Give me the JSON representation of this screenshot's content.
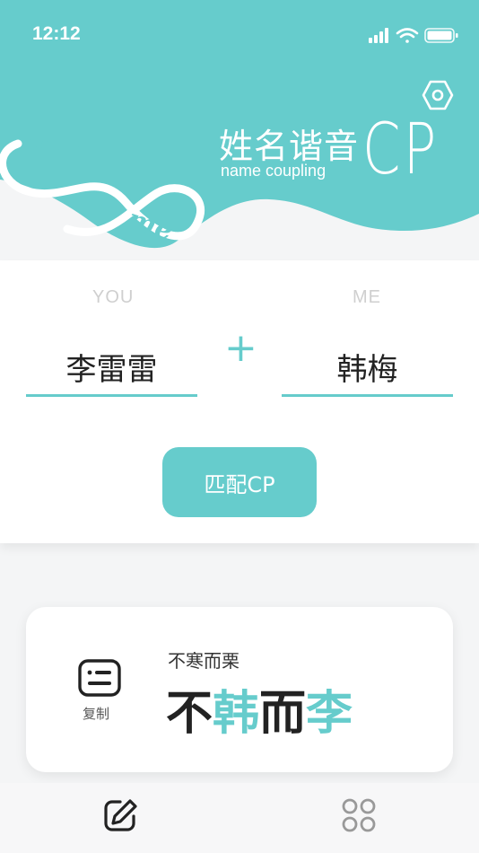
{
  "status_bar": {
    "time": "12:12"
  },
  "header": {
    "title_cn": "姓名谐音",
    "title_en": "name coupling",
    "title_cp": "CP",
    "logo_text_you": "you",
    "logo_text_me": "me"
  },
  "form": {
    "you_label": "YOU",
    "me_label": "ME",
    "you_name": "李雷雷",
    "me_name": "韩梅",
    "plus": "+",
    "match_button": "匹配CP"
  },
  "result": {
    "copy_label": "复制",
    "idiom": "不寒而栗",
    "pun_chars": [
      {
        "char": "不",
        "highlight": false
      },
      {
        "char": "韩",
        "highlight": true
      },
      {
        "char": "而",
        "highlight": false
      },
      {
        "char": "李",
        "highlight": true
      }
    ]
  },
  "tabs": [
    {
      "icon": "edit-icon",
      "active": true
    },
    {
      "icon": "grid-icon",
      "active": false
    }
  ],
  "colors": {
    "accent": "#66cccc",
    "dark_text": "#222222"
  }
}
